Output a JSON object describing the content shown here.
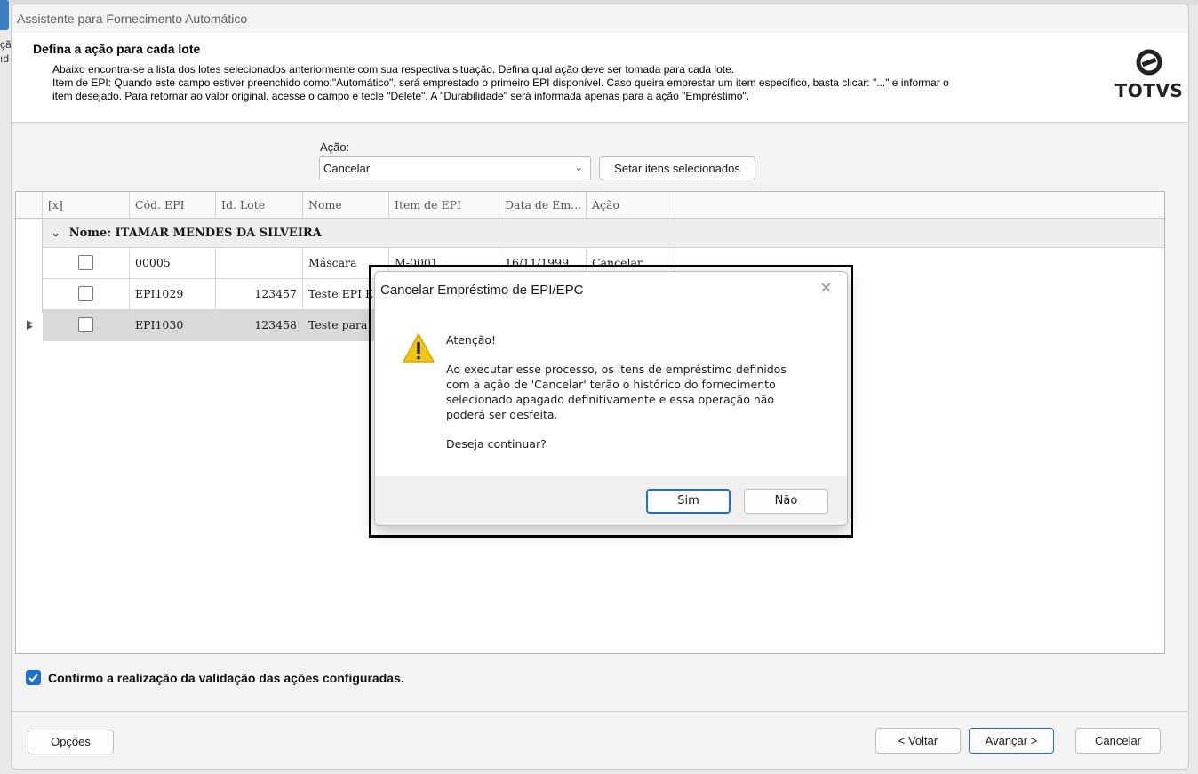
{
  "window": {
    "title": "Assistente para Fornecimento Automático"
  },
  "header": {
    "title": "Defina a ação para cada lote",
    "desc_lines": [
      "Abaixo encontra-se a lista dos lotes selecionados anteriormente com sua respectiva situação. Defina qual ação deve ser tomada para cada lote.",
      "Item de EPI: Quando este campo estiver preenchido como:\"Automático\", será emprestado o primeiro EPI disponível. Caso queira emprestar um item específico, basta clicar: \"...\" e informar o",
      "item desejado. Para retornar ao valor original, acesse o campo e tecle \"Delete\". A \"Durabilidade\" será informada apenas para a ação \"Empréstimo\"."
    ],
    "logo_text": "TOTVS"
  },
  "action_bar": {
    "label": "Ação:",
    "selected": "Cancelar",
    "set_button": "Setar itens selecionados"
  },
  "grid": {
    "columns": [
      "[x]",
      "Cód. EPI",
      "Id. Lote",
      "Nome",
      "Item de EPI",
      "Data de Em...",
      "Ação"
    ],
    "group": "Nome: ITAMAR MENDES DA SILVEIRA",
    "rows": [
      {
        "code": "00005",
        "lote": "",
        "nome": "Máscara",
        "item": "M-0001",
        "data": "16/11/1999",
        "acao": "Cancelar"
      },
      {
        "code": "EPI1029",
        "lote": "123457",
        "nome": "Teste EPI E",
        "item": "",
        "data": "",
        "acao": ""
      },
      {
        "code": "EPI1030",
        "lote": "123458",
        "nome": "Teste para",
        "item": "",
        "data": "",
        "acao": ""
      }
    ]
  },
  "confirm": {
    "label": "Confirmo a realização da validação das ações configuradas.",
    "checked": true
  },
  "footer": {
    "options": "Opções",
    "back": "< Voltar",
    "next": "Avançar >",
    "cancel": "Cancelar"
  },
  "dialog": {
    "title": "Cancelar Empréstimo de EPI/EPC",
    "heading": "Atenção!",
    "message_lines": [
      "Ao executar esse processo, os itens de empréstimo definidos",
      "com a ação de 'Cancelar' terão o histórico do fornecimento",
      "selecionado apagado definitivamente e essa operação não",
      "poderá ser desfeita."
    ],
    "question": "Deseja continuar?",
    "yes": "Sim",
    "no": "Não"
  },
  "background": {
    "side_text_1": "çã",
    "side_text_2": "ıd"
  },
  "colors": {
    "accent": "#1f6fcf",
    "warning": "#f2c511"
  }
}
